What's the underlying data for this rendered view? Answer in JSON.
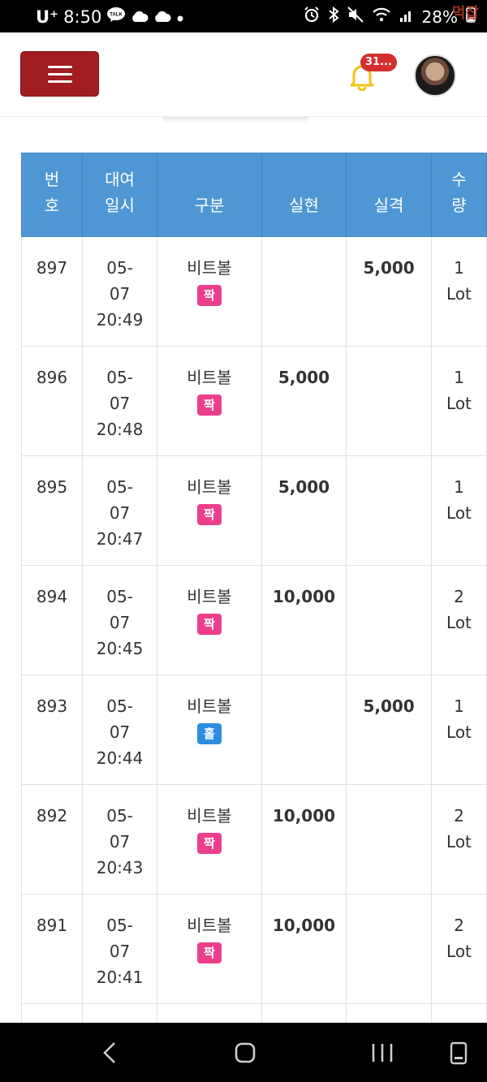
{
  "status_bar": {
    "carrier": "U⁺",
    "time": "8:50",
    "talk_label": "TALK",
    "battery": "28%",
    "watermark": "먹잡"
  },
  "header": {
    "notification_count": "31..."
  },
  "table": {
    "headers": {
      "no": [
        "번",
        "호"
      ],
      "datetime": [
        "대여",
        "일시"
      ],
      "type": "구분",
      "win": "실현",
      "lose": "실격",
      "qty": [
        "수",
        "량"
      ]
    },
    "rows": [
      {
        "no": "897",
        "date": "05-",
        "date2": "07",
        "time": "20:49",
        "type": "비트볼",
        "tag": "짝",
        "tag_color": "#ec3f8b",
        "win": "",
        "lose": "5,000",
        "qty": "1",
        "unit": "Lot"
      },
      {
        "no": "896",
        "date": "05-",
        "date2": "07",
        "time": "20:48",
        "type": "비트볼",
        "tag": "짝",
        "tag_color": "#ec3f8b",
        "win": "5,000",
        "lose": "",
        "qty": "1",
        "unit": "Lot"
      },
      {
        "no": "895",
        "date": "05-",
        "date2": "07",
        "time": "20:47",
        "type": "비트볼",
        "tag": "짝",
        "tag_color": "#ec3f8b",
        "win": "5,000",
        "lose": "",
        "qty": "1",
        "unit": "Lot"
      },
      {
        "no": "894",
        "date": "05-",
        "date2": "07",
        "time": "20:45",
        "type": "비트볼",
        "tag": "짝",
        "tag_color": "#ec3f8b",
        "win": "10,000",
        "lose": "",
        "qty": "2",
        "unit": "Lot"
      },
      {
        "no": "893",
        "date": "05-",
        "date2": "07",
        "time": "20:44",
        "type": "비트볼",
        "tag": "홀",
        "tag_color": "#2d8ee0",
        "win": "",
        "lose": "5,000",
        "qty": "1",
        "unit": "Lot"
      },
      {
        "no": "892",
        "date": "05-",
        "date2": "07",
        "time": "20:43",
        "type": "비트볼",
        "tag": "짝",
        "tag_color": "#ec3f8b",
        "win": "10,000",
        "lose": "",
        "qty": "2",
        "unit": "Lot"
      },
      {
        "no": "891",
        "date": "05-",
        "date2": "07",
        "time": "20:41",
        "type": "비트볼",
        "tag": "짝",
        "tag_color": "#ec3f8b",
        "win": "10,000",
        "lose": "",
        "qty": "2",
        "unit": "Lot"
      }
    ]
  },
  "nav": {
    "back_icon": "back-icon",
    "home_icon": "home-icon",
    "recents_icon": "recents-icon",
    "keyboard_icon": "keyboard-icon"
  }
}
